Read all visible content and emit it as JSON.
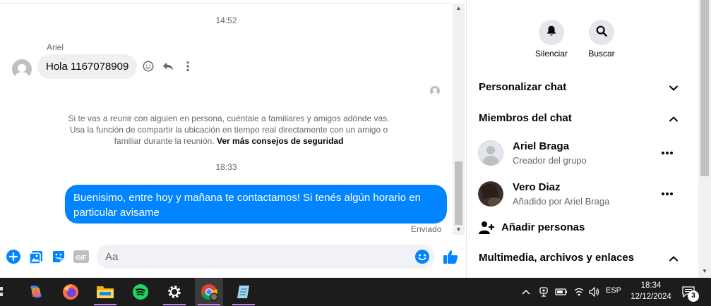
{
  "chat": {
    "time_first": "14:52",
    "sender_name": "Ariel",
    "incoming_message": "Hola 1167078909",
    "safety_text": "Si te vas a reunir con alguien en persona, cuéntale a familiares y amigos adónde vas. Usa la función de compartir la ubicación en tiempo real directamente con un amigo o familiar durante la reunión.",
    "safety_link": "Ver más consejos de seguridad",
    "time_second": "18:33",
    "outgoing_message": "Buenisimo, entre hoy y mañana te contactamos! Si tenés algún horario en particular avisame",
    "sent_status": "Enviado"
  },
  "composer": {
    "placeholder": "Aa",
    "icons": [
      "plus-circle-icon",
      "image-icon",
      "sticker-icon",
      "gif-icon",
      "emoji-icon",
      "like-icon"
    ]
  },
  "info_panel": {
    "mute_label": "Silenciar",
    "search_label": "Buscar",
    "customize_label": "Personalizar chat",
    "members_label": "Miembros del chat",
    "members": [
      {
        "name": "Ariel Braga",
        "subtitle": "Creador del grupo"
      },
      {
        "name": "Vero Diaz",
        "subtitle": "Añadido por Ariel Braga"
      }
    ],
    "add_people_label": "Añadir personas",
    "media_label": "Multimedia, archivos y enlaces"
  },
  "taskbar": {
    "language": "ESP",
    "time": "18:34",
    "date": "12/12/2024",
    "notification_count": "3"
  },
  "colors": {
    "messenger_blue": "#0084ff",
    "bubble_gray": "#f0f0f0",
    "taskbar_bg": "#1c1c1c"
  }
}
